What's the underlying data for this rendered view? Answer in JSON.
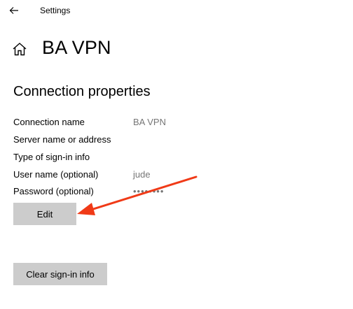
{
  "window": {
    "app_title": "Settings",
    "back_icon": "back-arrow-icon"
  },
  "header": {
    "icon": "home-icon",
    "title": "BA VPN"
  },
  "section": {
    "title": "Connection properties"
  },
  "properties": [
    {
      "label": "Connection name",
      "value": "BA VPN"
    },
    {
      "label": "Server name or address",
      "value": ""
    },
    {
      "label": "Type of sign-in info",
      "value": ""
    },
    {
      "label": "User name (optional)",
      "value": "jude"
    },
    {
      "label": "Password (optional)",
      "value": "••••••••"
    }
  ],
  "buttons": {
    "edit": "Edit",
    "clear": "Clear sign-in info"
  },
  "annotation": {
    "arrow_color": "#f03a17"
  },
  "colors": {
    "button_bg": "#cccccc",
    "muted_text": "#767676"
  }
}
